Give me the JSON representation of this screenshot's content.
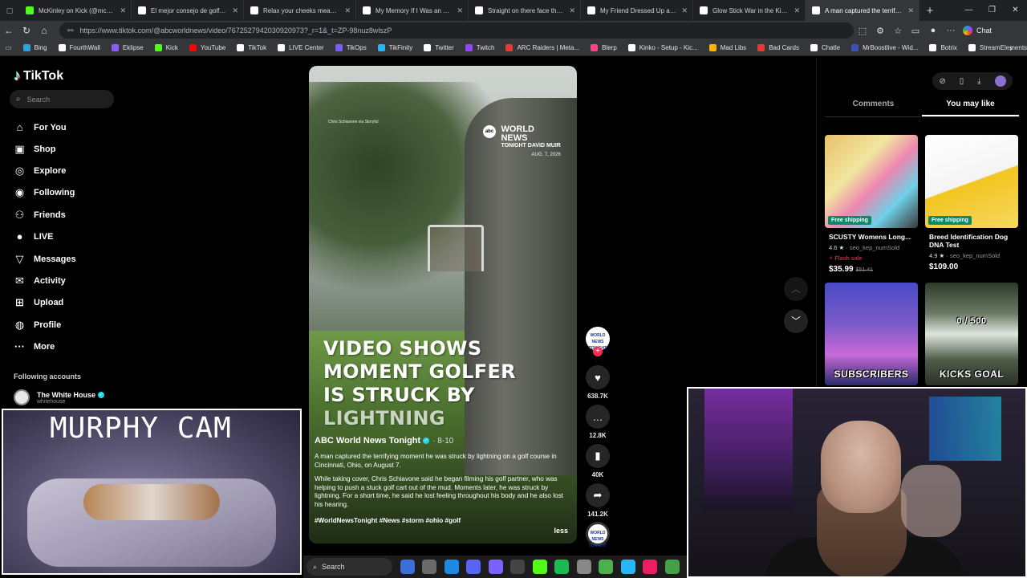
{
  "browser": {
    "tabs": [
      {
        "label": "McKinley on Kick (@mckinley.tv)",
        "color": "#53fc18",
        "active": false
      },
      {
        "label": "El mejor consejo de golf: técnica",
        "color": "#ffffff",
        "active": false
      },
      {
        "label": "Relax your cheeks meaning at the",
        "color": "#ffffff",
        "active": false
      },
      {
        "label": "My Memory If I Was an Uber Driver",
        "color": "#ffffff",
        "active": false
      },
      {
        "label": "Straight on there face tho 😭😭",
        "color": "#ffffff",
        "active": false
      },
      {
        "label": "My Friend Dressed Up as a Vehicle",
        "color": "#ffffff",
        "active": false
      },
      {
        "label": "Glow Stick War in the Kitchen: Fun",
        "color": "#ffffff",
        "active": false
      },
      {
        "label": "A man captured the terrifying mo",
        "color": "#ffffff",
        "active": true
      }
    ],
    "new_tab": "+",
    "window_controls": {
      "minimize": "—",
      "maximize": "❐",
      "close": "✕"
    },
    "url": "https://www.tiktok.com/@abcworldnews/video/7672527942030920973?_r=1&_t=ZP-98nuz8wlszP",
    "chat_label": "Chat",
    "bookmarks": [
      {
        "label": "Bing",
        "color": "#2aa3d8"
      },
      {
        "label": "FourthWall",
        "color": "#ffffff"
      },
      {
        "label": "Eklipse",
        "color": "#8a5cf6"
      },
      {
        "label": "Kick",
        "color": "#53fc18"
      },
      {
        "label": "YouTube",
        "color": "#ff0000"
      },
      {
        "label": "TikTok",
        "color": "#ffffff"
      },
      {
        "label": "LIVE Center",
        "color": "#ffffff"
      },
      {
        "label": "TikOps",
        "color": "#7a5cff"
      },
      {
        "label": "TikFinity",
        "color": "#29b6f6"
      },
      {
        "label": "Twitter",
        "color": "#ffffff"
      },
      {
        "label": "Twitch",
        "color": "#9146ff"
      },
      {
        "label": "ARC Raiders | Meta...",
        "color": "#e53935"
      },
      {
        "label": "Blerp",
        "color": "#ff4081"
      },
      {
        "label": "Kinko - Setup - Kic...",
        "color": "#ffffff"
      },
      {
        "label": "Mad Libs",
        "color": "#ffb300"
      },
      {
        "label": "Bad Cards",
        "color": "#e53935"
      },
      {
        "label": "Chatle",
        "color": "#ffffff"
      },
      {
        "label": "MrBoostlive - Wid...",
        "color": "#3f51b5"
      },
      {
        "label": "Botrix",
        "color": "#ffffff"
      },
      {
        "label": "StreamElements",
        "color": "#ffffff"
      }
    ],
    "bookmarks_more": "›"
  },
  "tiktok": {
    "logo": "TikTok",
    "search_placeholder": "Search",
    "nav": [
      {
        "label": "For You",
        "icon": "⌂",
        "name": "for-you"
      },
      {
        "label": "Shop",
        "icon": "▣",
        "name": "shop"
      },
      {
        "label": "Explore",
        "icon": "◎",
        "name": "explore"
      },
      {
        "label": "Following",
        "icon": "◉",
        "name": "following"
      },
      {
        "label": "Friends",
        "icon": "⚇",
        "name": "friends"
      },
      {
        "label": "LIVE",
        "icon": "●",
        "name": "live"
      },
      {
        "label": "Messages",
        "icon": "▽",
        "name": "messages"
      },
      {
        "label": "Activity",
        "icon": "✉",
        "name": "activity"
      },
      {
        "label": "Upload",
        "icon": "⊞",
        "name": "upload"
      },
      {
        "label": "Profile",
        "icon": "◍",
        "name": "profile"
      },
      {
        "label": "More",
        "icon": "···",
        "name": "more"
      }
    ],
    "following_accounts_heading": "Following accounts",
    "following_account": {
      "name": "The White House",
      "handle": "whitehouse"
    }
  },
  "video": {
    "credit": "Chris Schiavone via Storyful",
    "brand_abc": "abc",
    "brand_line1": "WORLD",
    "brand_line2": "NEWS",
    "brand_line3": "TONIGHT DAVID MUIR",
    "brand_date": "AUG. 7, 2026",
    "headline_line1": "VIDEO SHOWS",
    "headline_line2": "MOMENT GOLFER",
    "headline_line3": "IS STRUCK BY",
    "headline_line4": "LIGHTNING",
    "author": "ABC World News Tonight",
    "author_date": "· 8-10",
    "desc_p1": "A man captured the terrifying moment he was struck by lightning on a golf course in Cincinnati, Ohio, on August 7.",
    "desc_p2": "While taking cover, Chris Schiavone said he began filming his golf partner, who was helping to push a stuck golf cart out of the mud. Moments later, he was struck by lightning. For a short time, he said he lost feeling throughout his body and he also lost his hearing.",
    "hashtags": "#WorldNewsTonight #News #storm #ohio #golf",
    "less_label": "less"
  },
  "actions": {
    "avatar_text": "WORLD NEWS TONIGHT",
    "likes": "638.7K",
    "comments": "12.8K",
    "saves": "40K",
    "shares": "141.2K"
  },
  "right_panel": {
    "tabs": [
      {
        "label": "Comments",
        "active": false
      },
      {
        "label": "You may like",
        "active": true
      }
    ],
    "products": [
      {
        "title": "SCUSTY Womens Long...",
        "rating": "4.6 ★",
        "seller": "· seo_kep_numSold",
        "flash": "⚡ Flash sale",
        "price": "$35.99",
        "old_price": "$51.41",
        "badge": "Free shipping"
      },
      {
        "title": "Breed Identification Dog DNA Test",
        "rating": "4.9 ★",
        "seller": "· seo_kep_numSold",
        "flash": "",
        "price": "$109.00",
        "old_price": "",
        "badge": "Free shipping"
      }
    ],
    "thumb1_text": "SUBSCRIBERS",
    "thumb2_top": "0 / 500",
    "thumb2_text": "KICKS GOAL"
  },
  "overlays": {
    "murphy_cam_title": "MURPHY CAM"
  },
  "taskbar": {
    "search_label": "Search",
    "icon_colors": [
      "#3a6fd8",
      "#6a6a6a",
      "#1e88e5",
      "#5865f2",
      "#7b61ff",
      "#444",
      "#53fc18",
      "#1db954",
      "#888",
      "#4caf50",
      "#29b6f6",
      "#e91e63",
      "#43a047"
    ]
  }
}
